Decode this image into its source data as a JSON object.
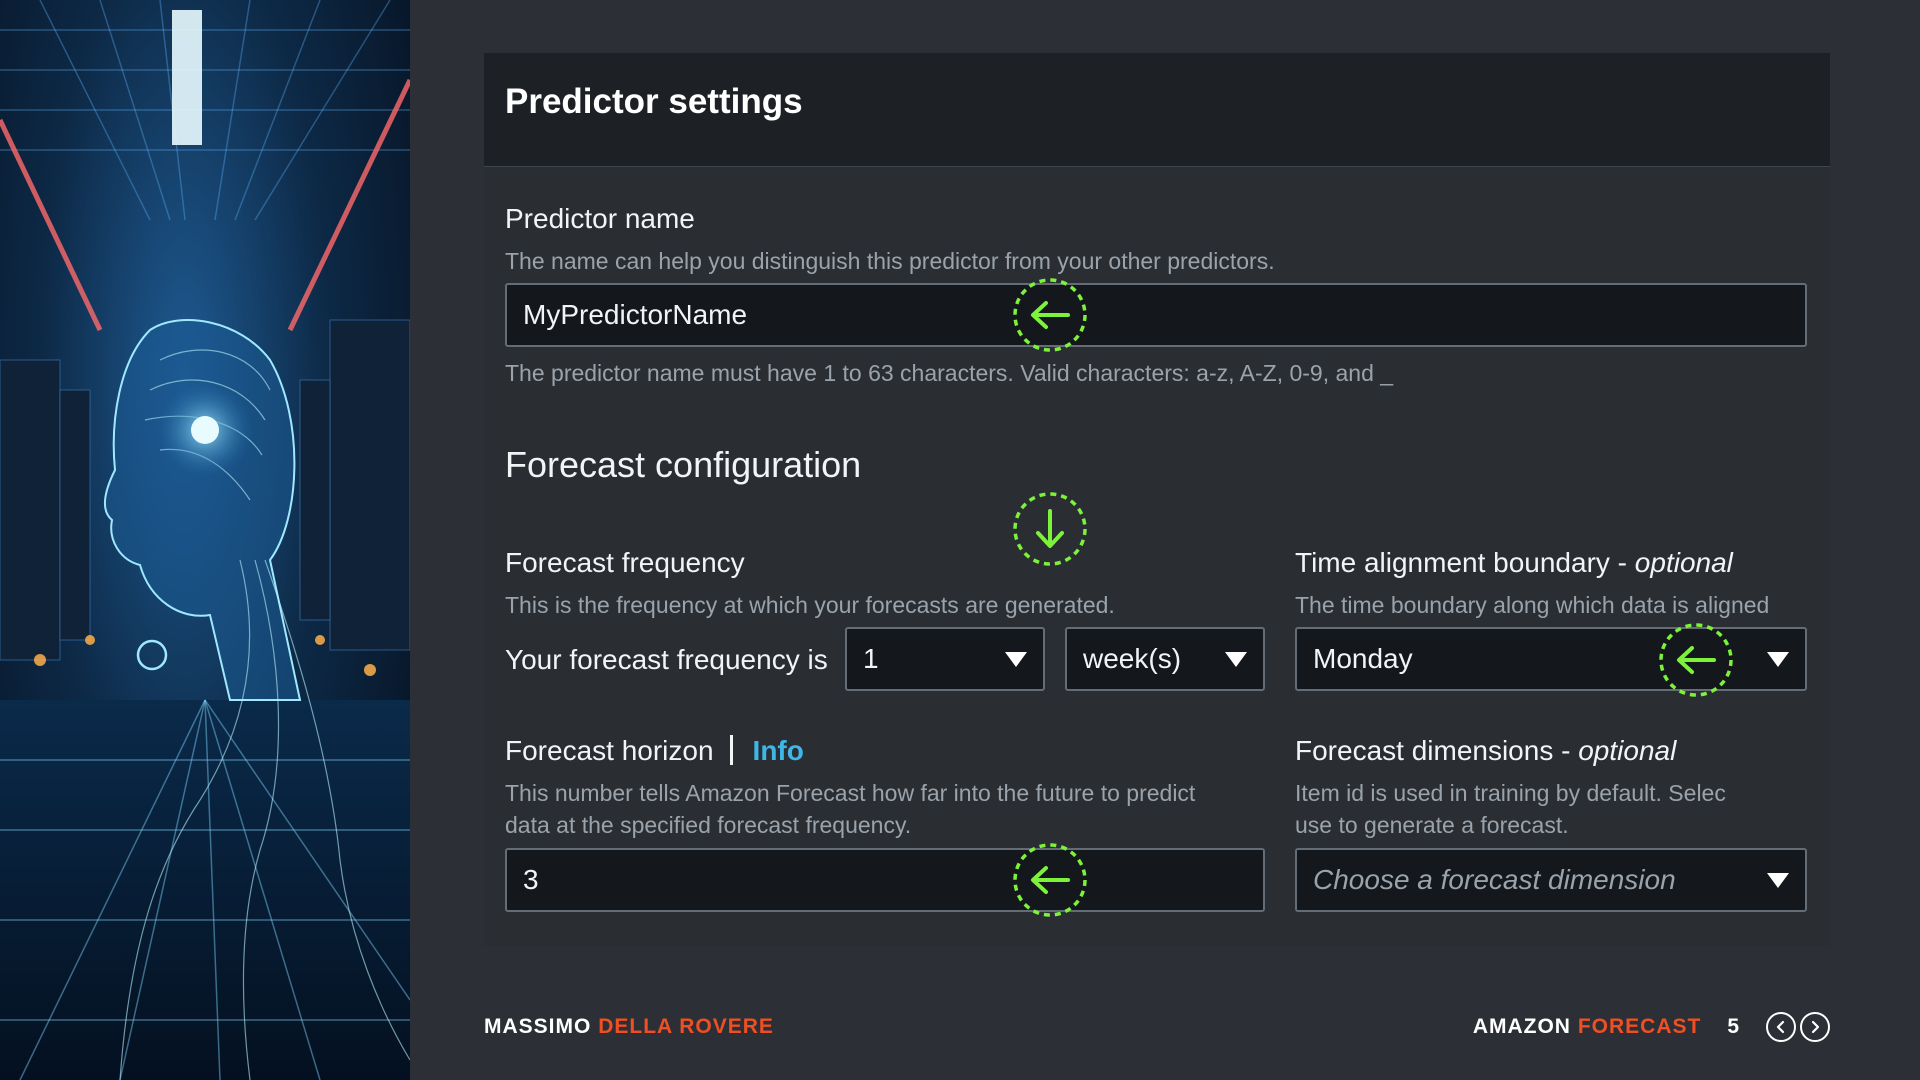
{
  "panel": {
    "title": "Predictor settings"
  },
  "predictor_name": {
    "label": "Predictor name",
    "description": "The name can help you distinguish this predictor from your other predictors.",
    "value": "MyPredictorName",
    "constraint": "The predictor name must have 1 to 63 characters. Valid characters: a-z, A-Z, 0-9, and _"
  },
  "forecast_configuration": {
    "title": "Forecast configuration",
    "frequency": {
      "label": "Forecast frequency",
      "description": "This is the frequency at which your forecasts are generated.",
      "prefix": "Your forecast frequency is",
      "count_value": "1",
      "unit_value": "week(s)"
    },
    "time_alignment": {
      "label": "Time alignment boundary",
      "optional": "optional",
      "description": "The time boundary along which data is aligned",
      "value": "Monday"
    },
    "horizon": {
      "label": "Forecast horizon",
      "info": "Info",
      "description_line1": "This number tells Amazon Forecast how far into the future to predict",
      "description_line2": "data at the specified forecast frequency.",
      "value": "3"
    },
    "dimensions": {
      "label": "Forecast dimensions",
      "optional": "optional",
      "description_line1": "Item id is used in training by default. Selec",
      "description_line2": "use to generate a forecast.",
      "placeholder": "Choose a forecast dimension"
    }
  },
  "footer": {
    "author_first": "MASSIMO",
    "author_last": "DELLA ROVERE",
    "brand_first": "AMAZON",
    "brand_last": "FORECAST",
    "page": "5"
  },
  "colors": {
    "accent": "#f04e23",
    "marker": "#7cf33a",
    "info_link": "#3fb6e8",
    "panel_header": "#1d2126",
    "input_bg": "#14171b"
  },
  "icons": [
    "arrow-left-marker-icon",
    "arrow-down-marker-icon",
    "dropdown-caret-icon",
    "chevron-left-icon",
    "chevron-right-icon"
  ]
}
